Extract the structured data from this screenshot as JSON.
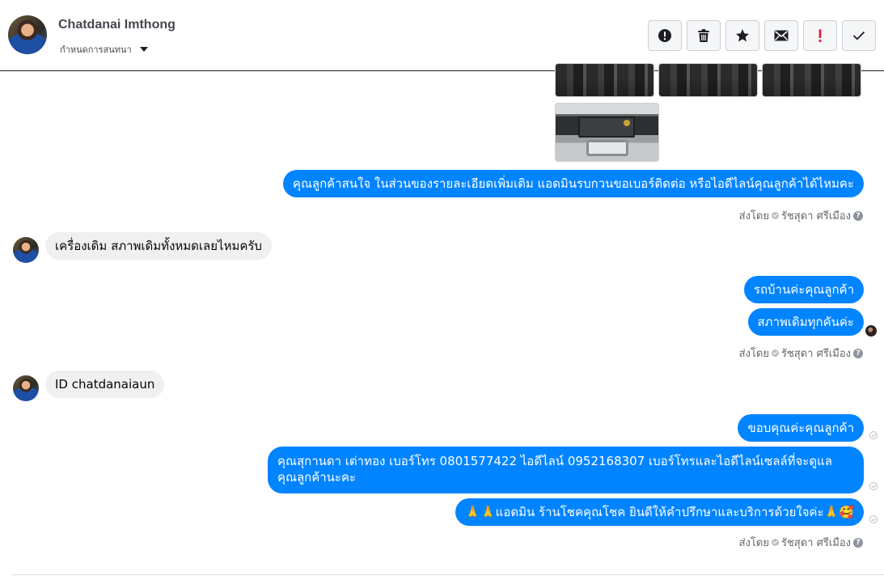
{
  "header": {
    "contact_name": "Chatdanai Imthong",
    "assign_label": "กำหนดการสนทนา",
    "toolbar": [
      {
        "icon": "alert-circle-icon"
      },
      {
        "icon": "trash-icon"
      },
      {
        "icon": "star-icon"
      },
      {
        "icon": "mail-icon"
      },
      {
        "icon": "exclamation-icon",
        "color": "#e41e3f"
      },
      {
        "icon": "check-icon"
      }
    ]
  },
  "colors": {
    "outgoing_bubble": "#0084ff",
    "incoming_bubble": "#f1f0f0",
    "secondary_text": "#65676b"
  },
  "messages": {
    "m1": "คุณลูกค้าสนใจ ในส่วนของรายละเอียดเพิ่มเติม แอดมินรบกวนขอเบอร์ติดต่อ หรือไอดีไลน์คุณลูกค้าได้ไหมคะ",
    "sent_by_1": "ส่งโดย",
    "sender_1": "รัชสุดา ศรีเมือง",
    "m2": "เครื่องเดิม สภาพเดิมทั้งหมดเลยไหมครับ",
    "m3": "รถบ้านค่ะคุณลูกค้า",
    "m4": "สภาพเดิมทุกคันค่ะ",
    "sent_by_2": "ส่งโดย",
    "sender_2": "รัชสุดา ศรีเมือง",
    "m5": "ID chatdanaiaun",
    "m6": "ขอบคุณค่ะคุณลูกค้า",
    "m7_line1": "คุณสุกานดา เต่าทอง      เบอร์โทร 0801577422  ไอดีไลน์ 0952168307  เบอร์โทรและไอดีไลน์เซลล์ที่จะดูแล",
    "m7_line2": "คุณลูกค้านะคะ",
    "m8": "🙏🙏แอดมิน ร้านโชคคุณโชค ยินดีให้คำปรึกษาและบริการด้วยใจค่ะ🙏🥰",
    "sent_by_3": "ส่งโดย",
    "sender_3": "รัชสุดา ศรีเมือง"
  }
}
